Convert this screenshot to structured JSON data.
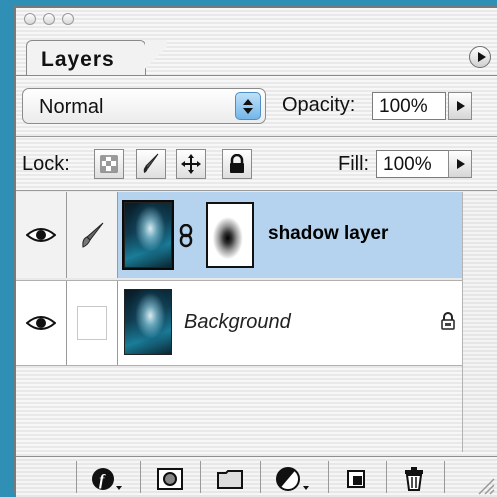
{
  "panel": {
    "tab_label": "Layers"
  },
  "blend": {
    "mode": "Normal",
    "opacity_label": "Opacity:",
    "opacity_value": "100%"
  },
  "lock": {
    "label": "Lock:",
    "fill_label": "Fill:",
    "fill_value": "100%"
  },
  "layers": [
    {
      "name": "shadow layer",
      "selected": true,
      "visible": true,
      "has_mask": true,
      "linked_brush": true
    },
    {
      "name": "Background",
      "selected": false,
      "visible": true,
      "locked": true
    }
  ],
  "bottom_bar": {
    "buttons": [
      "layer-style",
      "add-mask",
      "new-set",
      "new-fill-adjustment",
      "new-layer",
      "delete-layer"
    ]
  },
  "colors": {
    "background": "#2f8fb5",
    "selected_row": "#b5d3ee",
    "stepper_blue": "#74b7ea"
  }
}
